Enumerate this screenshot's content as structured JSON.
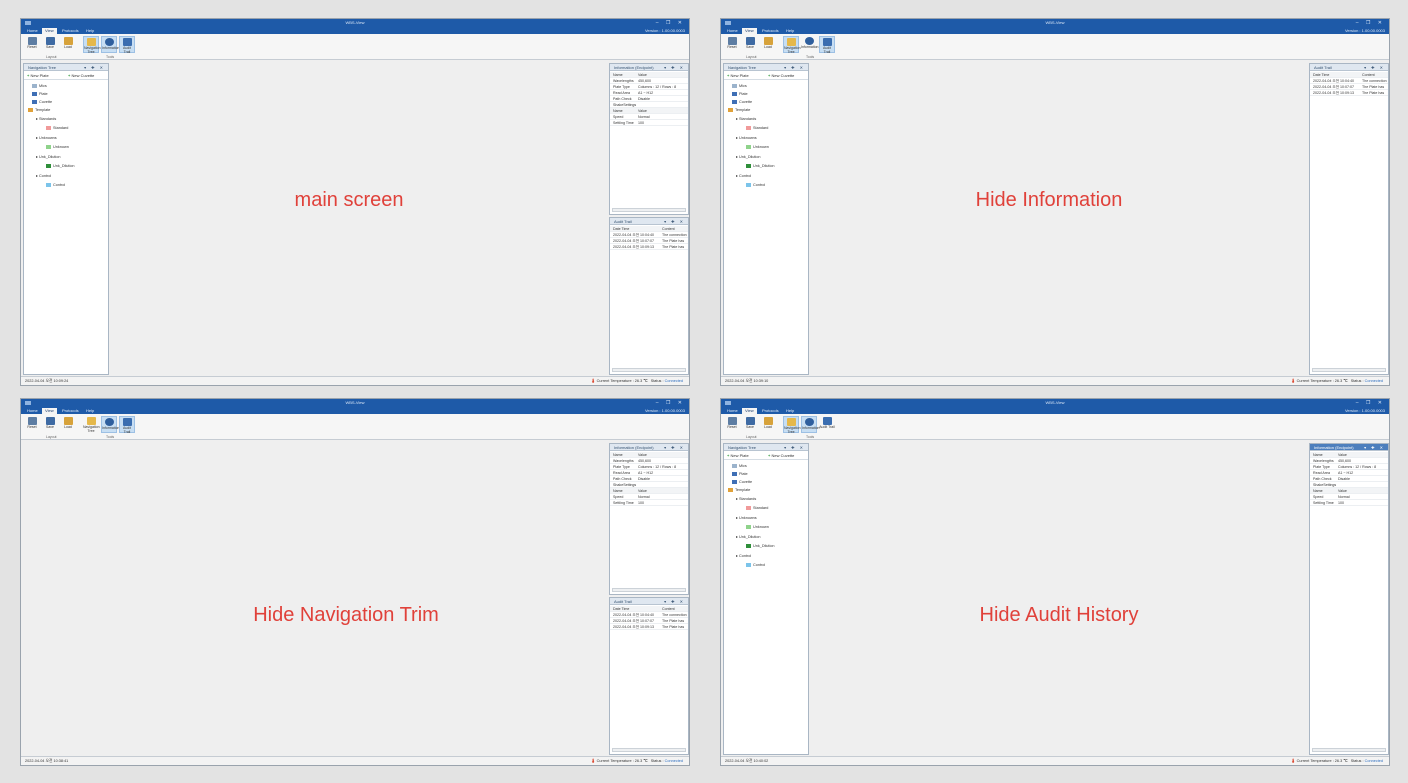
{
  "app": {
    "title": "WBS-View",
    "menu": [
      "Home",
      "View",
      "Protocols",
      "Help"
    ],
    "version": "Version : 1.00.00.0003",
    "window_controls": "– ❐ ✕"
  },
  "ribbon": {
    "buttons": [
      {
        "label": "Reset",
        "icon": "reset-icon"
      },
      {
        "label": "Save",
        "icon": "save-icon"
      },
      {
        "label": "Load",
        "icon": "load-icon"
      },
      {
        "label": "Navigation Tree",
        "icon": "navigation-tree-icon"
      },
      {
        "label": "Information",
        "icon": "information-icon"
      },
      {
        "label": "Audit Trail",
        "icon": "audit-trail-icon"
      }
    ],
    "groups": [
      "Layout",
      "Tools"
    ]
  },
  "navigation": {
    "title": "Navigation Tree",
    "pins": "▾ ✚ ✕",
    "new_plate": "New Plate",
    "new_cuvette": "New Cuvette",
    "tree": [
      {
        "label": "Mics",
        "indent": 1
      },
      {
        "label": "Plate",
        "indent": 1
      },
      {
        "label": "Cuvette",
        "indent": 1
      },
      {
        "label": "Template",
        "indent": 1
      },
      {
        "label": "Standards",
        "indent": 2
      },
      {
        "label": "Standard",
        "indent": 3
      },
      {
        "label": "Unknowns",
        "indent": 2
      },
      {
        "label": "Unknown",
        "indent": 3
      },
      {
        "label": "Unk_Dilution",
        "indent": 2
      },
      {
        "label": "Unk_Dilution",
        "indent": 3
      },
      {
        "label": "Control",
        "indent": 2
      },
      {
        "label": "Control",
        "indent": 3
      }
    ]
  },
  "information": {
    "title": "Information (Endpoint)",
    "header": [
      "Name",
      "Value"
    ],
    "rows": [
      [
        "Wavelengths",
        "450,600"
      ],
      [
        "Plate Type",
        "Columns : 12 / Rows : 8"
      ],
      [
        "Read Area",
        "A1 ~ H12"
      ],
      [
        "Path Check",
        "Disable"
      ],
      [
        "ShakeSettings",
        ""
      ]
    ],
    "sub_header": [
      "Name",
      "Value"
    ],
    "sub_rows": [
      [
        "Speed",
        "Normal"
      ],
      [
        "Settling Time",
        "100"
      ]
    ]
  },
  "audit": {
    "title": "Audit Trail",
    "header": [
      "Date Time",
      "Content"
    ],
    "rows": [
      [
        "2022-04-04 오전 10:04:40",
        "The connection"
      ],
      [
        "2022-04-04 오전 10:07:07",
        "The Plate has"
      ],
      [
        "2022-04-04 오전 10:09:13",
        "The Plate has"
      ]
    ]
  },
  "status_bar": {
    "temperature": "Current Temperature : 26.3 ℃",
    "status_label": "Status :",
    "status_value": "Connected"
  },
  "screens": [
    {
      "caption": "main screen",
      "timestamp": "2022-04-04 오전 10:09:24"
    },
    {
      "caption": "Hide Information",
      "timestamp": "2022-04-04 오전 10:39:10"
    },
    {
      "caption": "Hide Navigation Trim",
      "timestamp": "2022-04-04 오전 10:38:41"
    },
    {
      "caption": "Hide Audit History",
      "timestamp": "2022-04-04 오전 10:40:02"
    }
  ],
  "colors": {
    "title_bar": "#1e5aa8",
    "caption": "#e0413a",
    "selected_ribbon": "#c7def3"
  }
}
